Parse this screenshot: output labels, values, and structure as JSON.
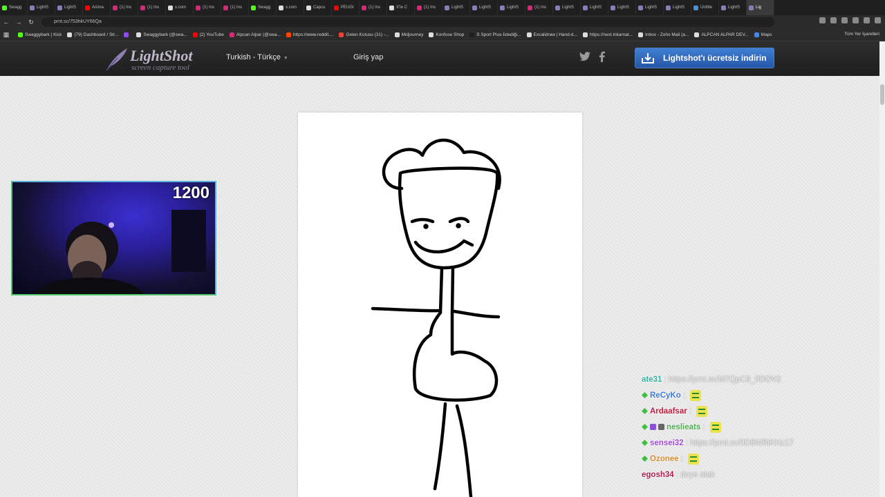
{
  "browser": {
    "tabs": [
      {
        "label": "Swagg",
        "color": "#53fc18"
      },
      {
        "label": "LightS",
        "color": "#8a7bbd"
      },
      {
        "label": "LightS",
        "color": "#8a7bbd"
      },
      {
        "label": "Anima",
        "color": "#ff0000"
      },
      {
        "label": "(1) Ins",
        "color": "#d62976"
      },
      {
        "label": "(1) Ins",
        "color": "#d62976"
      },
      {
        "label": "x.com",
        "color": "#dddddd"
      },
      {
        "label": "(1) Ins",
        "color": "#d62976"
      },
      {
        "label": "(1) Ins",
        "color": "#d62976"
      },
      {
        "label": "Swagg",
        "color": "#53fc18"
      },
      {
        "label": "x.com",
        "color": "#dddddd"
      },
      {
        "label": "Capcu",
        "color": "#dddddd"
      },
      {
        "label": "PEUGI",
        "color": "#ff0000"
      },
      {
        "label": "(1) Ins",
        "color": "#d62976"
      },
      {
        "label": "X'te C",
        "color": "#dddddd"
      },
      {
        "label": "(1) Ins",
        "color": "#d62976"
      },
      {
        "label": "LightS",
        "color": "#8a7bbd"
      },
      {
        "label": "LightS",
        "color": "#8a7bbd"
      },
      {
        "label": "LightS",
        "color": "#8a7bbd"
      },
      {
        "label": "(1) Ins",
        "color": "#d62976"
      },
      {
        "label": "LightS",
        "color": "#8a7bbd"
      },
      {
        "label": "LightS",
        "color": "#8a7bbd"
      },
      {
        "label": "LightS",
        "color": "#8a7bbd"
      },
      {
        "label": "LightS",
        "color": "#8a7bbd"
      },
      {
        "label": "LightS",
        "color": "#8a7bbd"
      },
      {
        "label": "Untitle",
        "color": "#4a90d9"
      },
      {
        "label": "LightS",
        "color": "#8a7bbd"
      },
      {
        "label": "Lig",
        "color": "#8a7bbd",
        "active": true
      }
    ],
    "url": "prnt.sc/753hkUY66Qa",
    "bookmarks": [
      {
        "label": "Swaggybark | Kick",
        "color": "#53fc18"
      },
      {
        "label": "(79) Dashboard / Str...",
        "color": "#dddddd"
      },
      {
        "label": "",
        "color": "#9146ff"
      },
      {
        "label": "Swaggybark (@swa...",
        "color": "#dddddd"
      },
      {
        "label": "(2) YouTube",
        "color": "#ff0000"
      },
      {
        "label": "Alpcan Alpar (@swa...",
        "color": "#d62976"
      },
      {
        "label": "https://www.reddit....",
        "color": "#ff4500"
      },
      {
        "label": "Gelen Kutusu (31) -...",
        "color": "#ea4335"
      },
      {
        "label": "Midjourney",
        "color": "#dddddd"
      },
      {
        "label": "Konfuse Shop",
        "color": "#dddddd"
      },
      {
        "label": "S Sport Plus-İstediği...",
        "color": "#1e1e1e"
      },
      {
        "label": "Excalidraw | Hand-d...",
        "color": "#dddddd"
      },
      {
        "label": "https://next.inkarnat...",
        "color": "#dddddd"
      },
      {
        "label": "Inbox - Zoho Mail (a...",
        "color": "#dddddd"
      },
      {
        "label": "ALPCAN ALPAR DEV...",
        "color": "#dddddd"
      },
      {
        "label": "Maps",
        "color": "#4285f4"
      }
    ],
    "all_bookmarks_label": "Tüm Yer İşaretleri"
  },
  "lightshot": {
    "logo_title": "LightShot",
    "logo_subtitle": "screen capture tool",
    "language": "Turkish - Türkçe",
    "login": "Giriş yap",
    "download_button": "Lightshot'ı ücretsiz indirin"
  },
  "stream": {
    "webcam_count": "1200",
    "chat": [
      {
        "user": "ate31",
        "user_color": "#2bb3a0",
        "message": "https://prnt.sc/M7QpC9_0DOV2",
        "badges": []
      },
      {
        "user": "ReCyKo",
        "user_color": "#3c7ad8",
        "message": "",
        "badges": [
          "green"
        ],
        "emote": true
      },
      {
        "user": "Ardaafsar",
        "user_color": "#c2183a",
        "message": "",
        "badges": [
          "green"
        ],
        "emote": true
      },
      {
        "user": "neslieats",
        "user_color": "#4caf50",
        "message": "",
        "badges": [
          "green",
          "purple",
          "gray"
        ],
        "emote": true
      },
      {
        "user": "sensei32",
        "user_color": "#a24bd9",
        "message": "https://prnt.sc/0D8WBIKHz17",
        "badges": [
          "green"
        ]
      },
      {
        "user": "Ozonee",
        "user_color": "#d88b2a",
        "message": "",
        "badges": [
          "green"
        ],
        "emote": true
      },
      {
        "user": "egosh34",
        "user_color": "#b01e4e",
        "message": "deye atak",
        "badges": []
      }
    ]
  }
}
